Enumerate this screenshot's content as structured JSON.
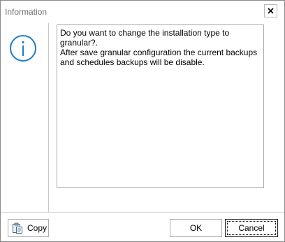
{
  "window": {
    "title": "Information"
  },
  "message": {
    "line1": "Do you want to change the installation type to granular?.",
    "line2": "After save granular configuration the current backups and schedules backups will be disable."
  },
  "buttons": {
    "copy_label": "Copy",
    "ok_label": "OK",
    "cancel_label": "Cancel"
  },
  "icons": {
    "info": "info-icon",
    "close": "close-icon",
    "copy": "clipboard-icon"
  },
  "colors": {
    "icon_accent": "#1a7dc4"
  }
}
